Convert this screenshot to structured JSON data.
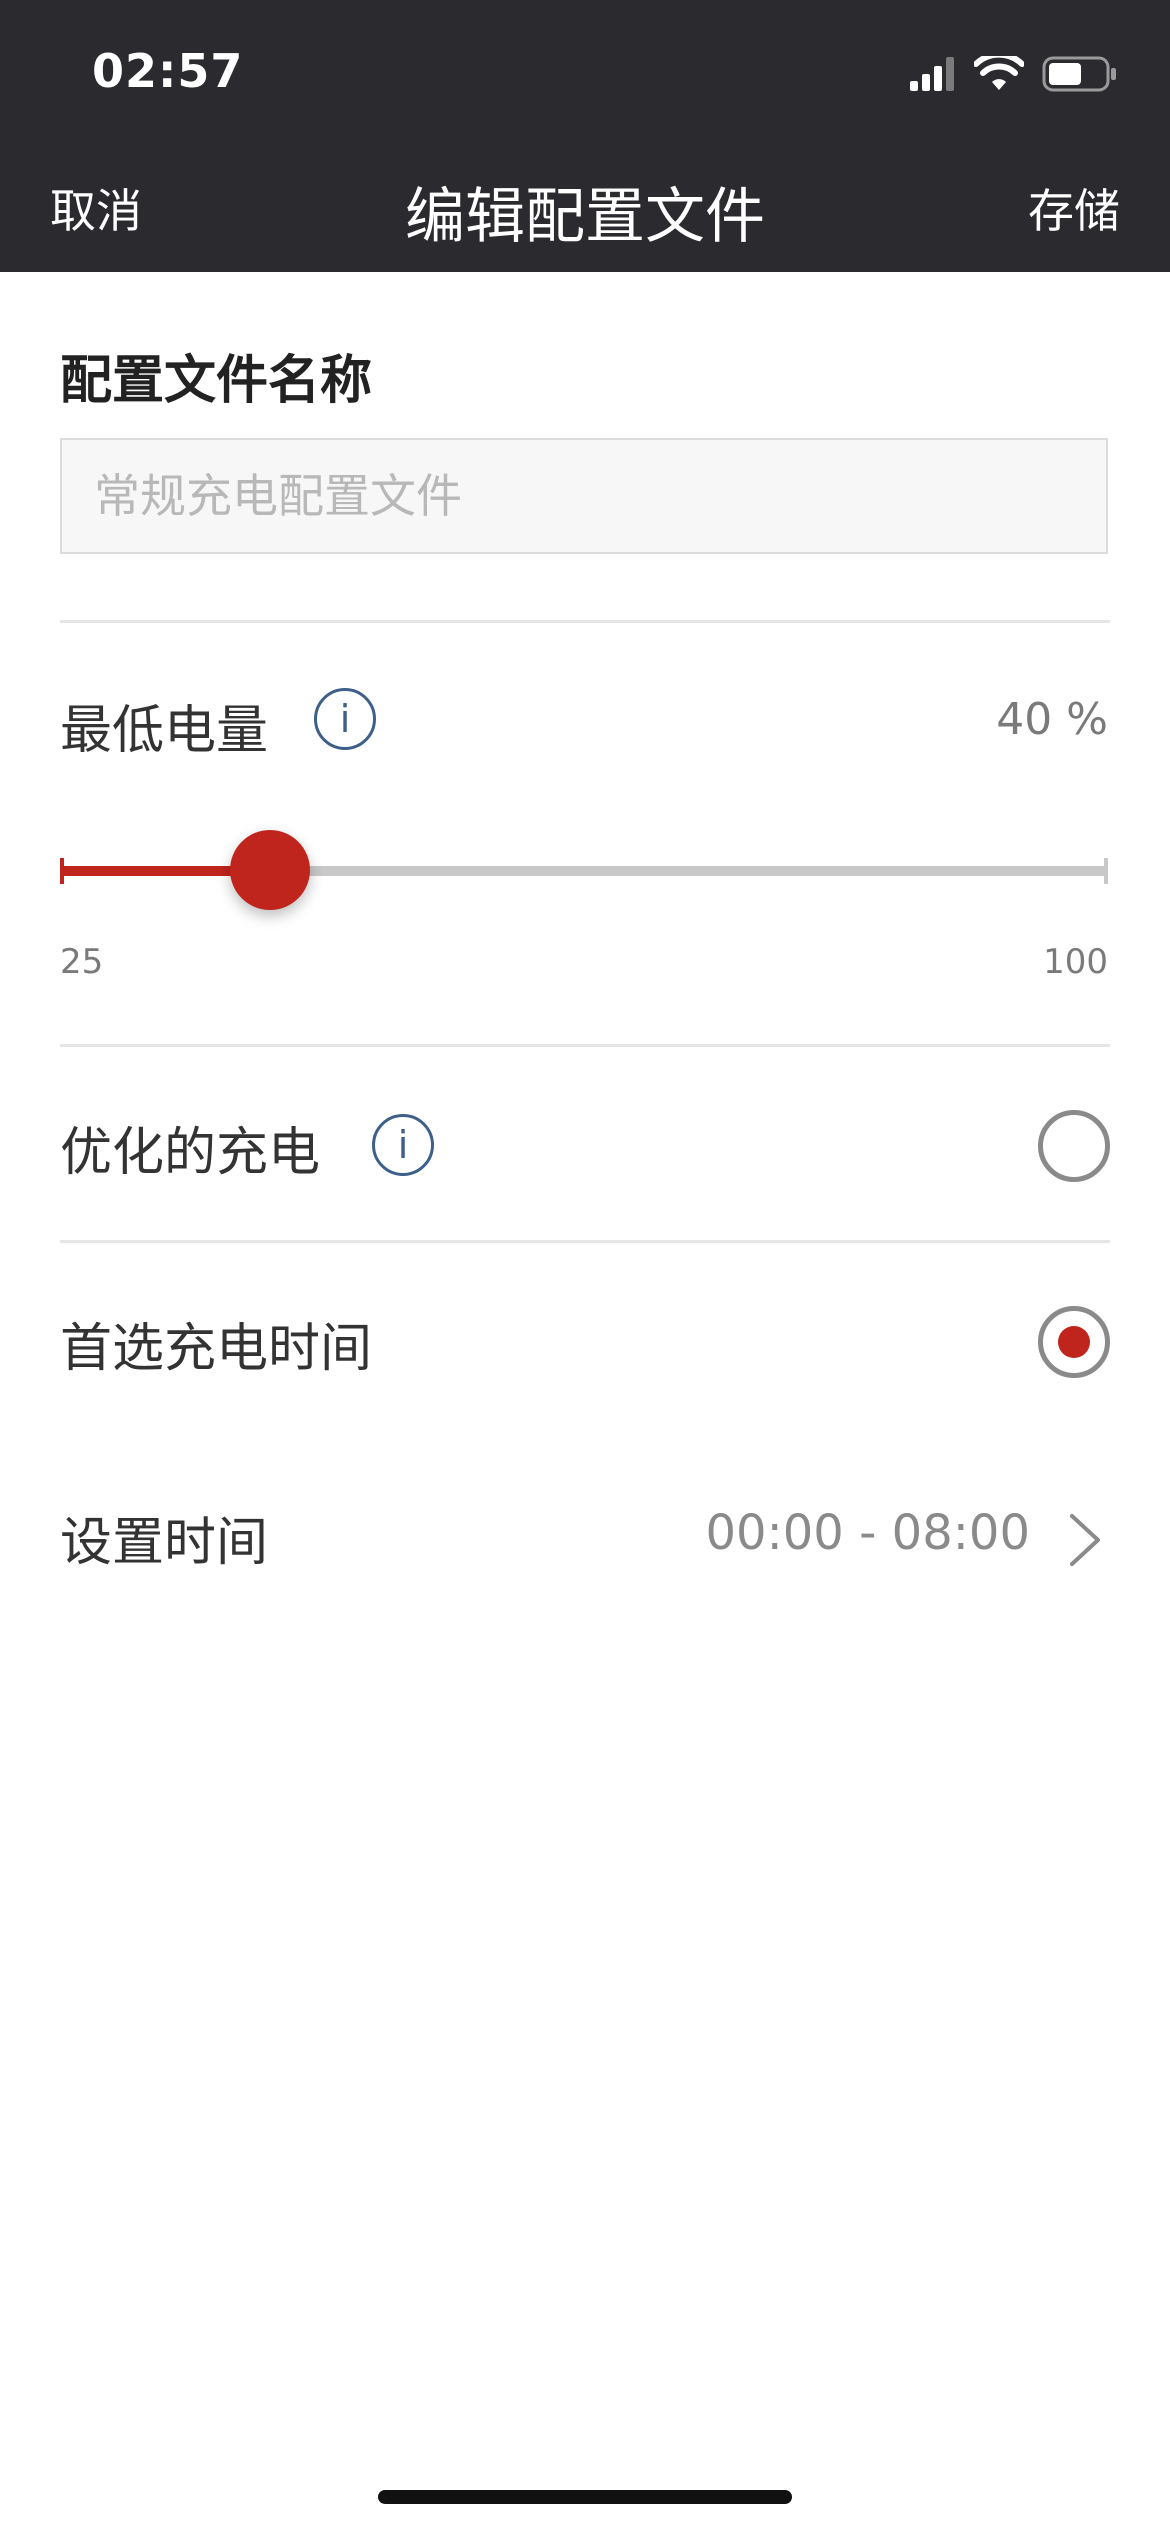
{
  "status_bar": {
    "time": "02:57"
  },
  "nav": {
    "cancel_label": "取消",
    "title": "编辑配置文件",
    "save_label": "存储"
  },
  "profile_name": {
    "label": "配置文件名称",
    "value": "",
    "placeholder": "常规充电配置文件"
  },
  "min_battery": {
    "label": "最低电量",
    "value_text": "40 %",
    "value": 40,
    "min": 25,
    "max": 100,
    "min_label": "25",
    "max_label": "100"
  },
  "optimized_charging": {
    "label": "优化的充电",
    "selected": false
  },
  "preferred_charge_time": {
    "label": "首选充电时间",
    "selected": true
  },
  "set_time": {
    "label": "设置时间",
    "value": "00:00 - 08:00"
  },
  "info_icon_glyph": "i",
  "colors": {
    "accent": "#c0251d",
    "header_bg": "#2b2b2f",
    "info_blue": "#3d5f8a"
  },
  "icons": [
    "signal-icon",
    "wifi-icon",
    "battery-icon",
    "info-icon",
    "chevron-right-icon"
  ]
}
